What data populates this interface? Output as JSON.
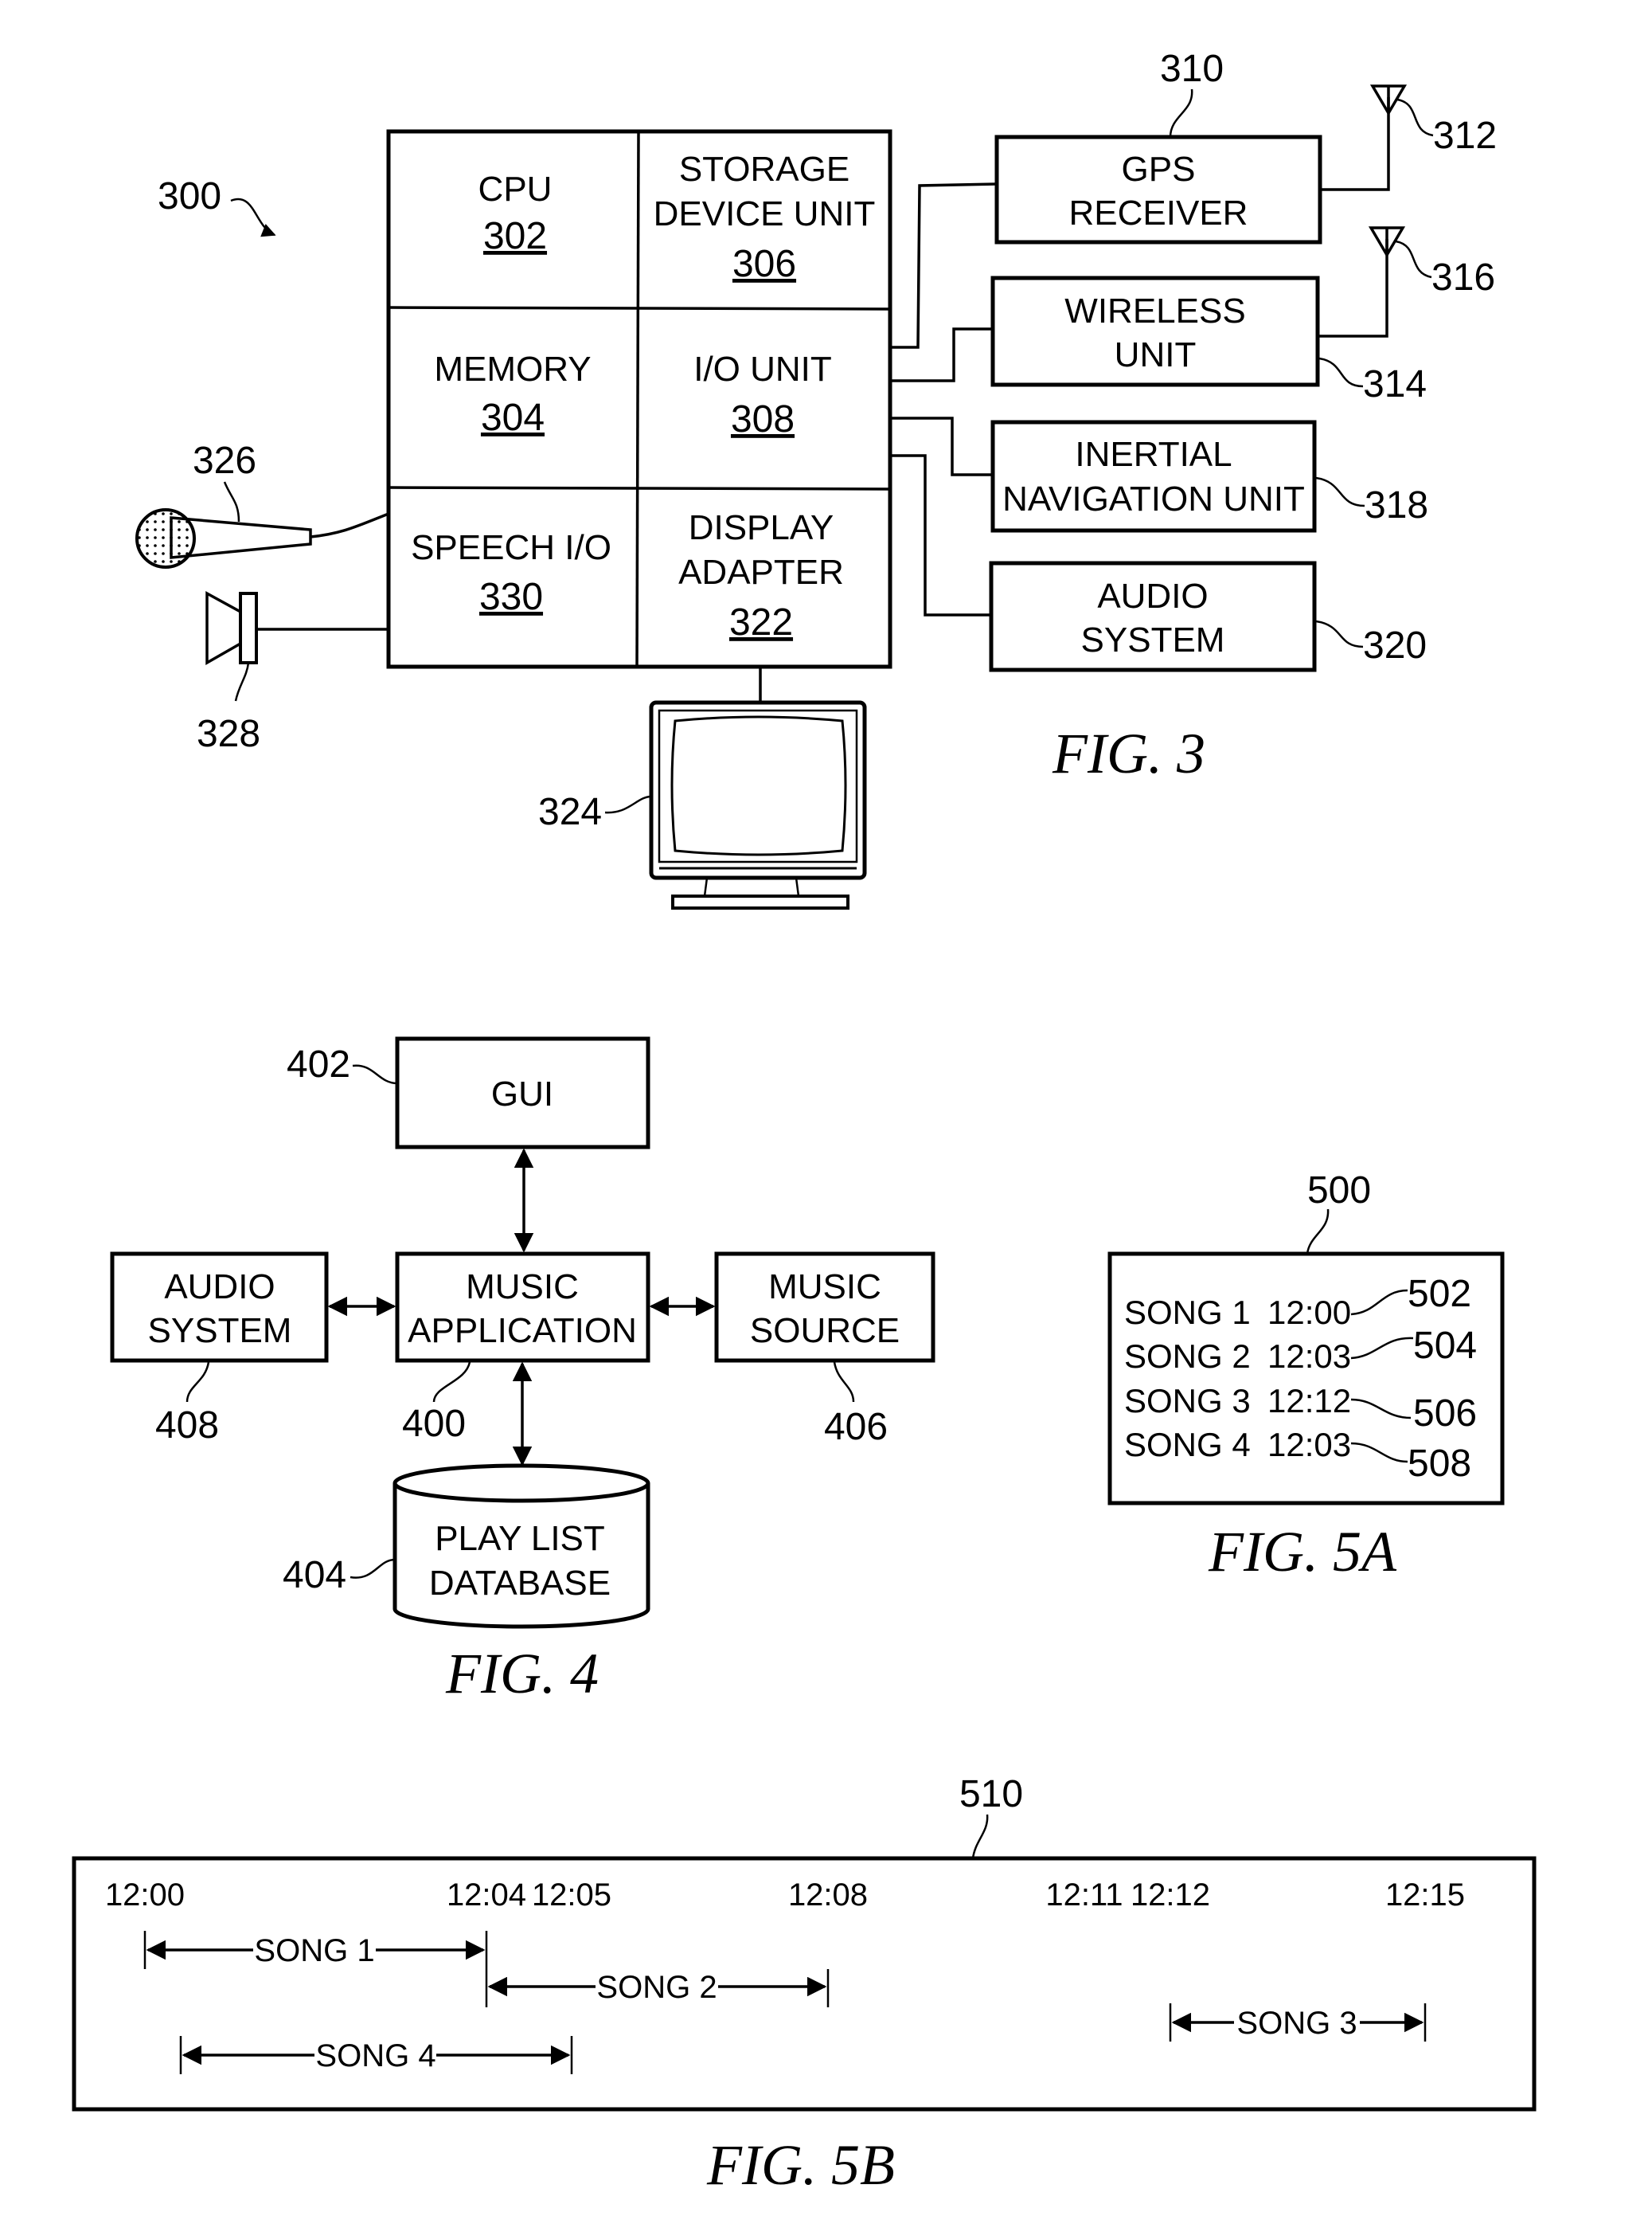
{
  "fig3": {
    "caption": "FIG. 3",
    "system_ref": "300",
    "blocks": {
      "cpu": {
        "line1": "CPU",
        "ref": "302"
      },
      "storage": {
        "line1": "STORAGE",
        "line2": "DEVICE UNIT",
        "ref": "306"
      },
      "memory": {
        "line1": "MEMORY",
        "ref": "304"
      },
      "io": {
        "line1": "I/O UNIT",
        "ref": "308"
      },
      "speech": {
        "line1": "SPEECH I/O",
        "ref": "330"
      },
      "display": {
        "line1": "DISPLAY",
        "line2": "ADAPTER",
        "ref": "322"
      }
    },
    "peripherals": {
      "gps": {
        "line1": "GPS",
        "line2": "RECEIVER",
        "ref": "310",
        "antenna_ref": "312"
      },
      "wireless": {
        "line1": "WIRELESS",
        "line2": "UNIT",
        "ref": "314",
        "antenna_ref": "316"
      },
      "inertial": {
        "line1": "INERTIAL",
        "line2": "NAVIGATION UNIT",
        "ref": "318"
      },
      "audio": {
        "line1": "AUDIO",
        "line2": "SYSTEM",
        "ref": "320"
      }
    },
    "microphone_ref": "326",
    "speaker_ref": "328",
    "monitor_ref": "324"
  },
  "fig4": {
    "caption": "FIG. 4",
    "gui": {
      "label": "GUI",
      "ref": "402"
    },
    "music_app": {
      "line1": "MUSIC",
      "line2": "APPLICATION",
      "ref": "400"
    },
    "audio_system": {
      "line1": "AUDIO",
      "line2": "SYSTEM",
      "ref": "408"
    },
    "music_source": {
      "line1": "MUSIC",
      "line2": "SOURCE",
      "ref": "406"
    },
    "playlist_db": {
      "line1": "PLAY LIST",
      "line2": "DATABASE",
      "ref": "404"
    }
  },
  "fig5a": {
    "caption": "FIG. 5A",
    "ref": "500",
    "rows": [
      {
        "song": "SONG 1",
        "time": "12:00",
        "ref": "502"
      },
      {
        "song": "SONG 2",
        "time": "12:03",
        "ref": "504"
      },
      {
        "song": "SONG 3",
        "time": "12:12",
        "ref": "506"
      },
      {
        "song": "SONG 4",
        "time": "12:03",
        "ref": "508"
      }
    ]
  },
  "fig5b": {
    "caption": "FIG. 5B",
    "ref": "510",
    "ticks": [
      "12:00",
      "12:04",
      "12:05",
      "12:08",
      "12:11",
      "12:12",
      "12:15"
    ],
    "spans": [
      {
        "label": "SONG 1",
        "start": "12:00",
        "end": "12:04"
      },
      {
        "label": "SONG 2",
        "start": "12:04",
        "end": "12:08"
      },
      {
        "label": "SONG 3",
        "start": "12:12",
        "end": "12:15"
      },
      {
        "label": "SONG 4",
        "start": "12:00.5",
        "end": "12:05"
      }
    ]
  }
}
